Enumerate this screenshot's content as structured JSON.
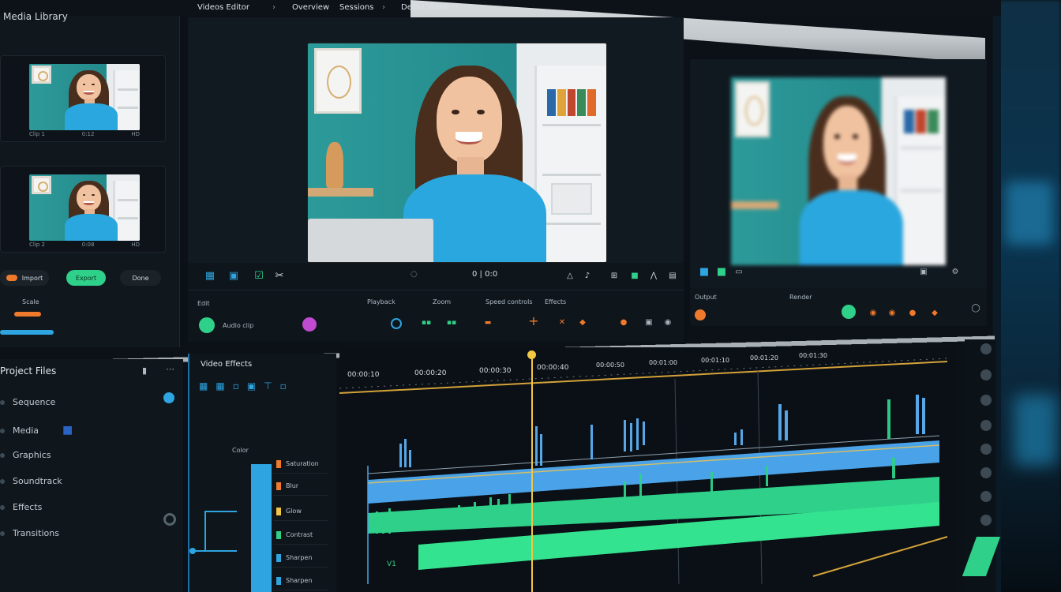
{
  "breadcrumb": {
    "app": "Videos Editor",
    "item1": "Overview",
    "item2": "Sessions",
    "item3": "Demo Video"
  },
  "left_panel": {
    "title": "Media Library",
    "thumb_captions": [
      [
        "Clip 1",
        "0:12",
        "HD"
      ],
      [
        "Clip 2",
        "0:08",
        "HD"
      ]
    ],
    "pills": [
      "Import",
      "Export",
      "Done"
    ],
    "slider_label": "Scale"
  },
  "viewer": {
    "timecode": "0 | 0:0",
    "toolbar_icons": [
      "crop-icon",
      "fit-icon",
      "check-icon",
      "cut-icon"
    ]
  },
  "controls": {
    "label_left": "Edit",
    "label_clip": "Playback",
    "label_zoom": "Zoom",
    "label_speed": "Speed controls",
    "label_effects": "Effects",
    "label_audio": "Audio clip"
  },
  "second_controls": {
    "label": "Output",
    "label2": "Render"
  },
  "project": {
    "title": "Project Files",
    "items": [
      "Sequence",
      "Media",
      "Graphics",
      "Soundtrack",
      "Effects",
      "Transitions"
    ]
  },
  "effects": {
    "title": "Video Effects",
    "group": "Color",
    "rows": [
      "Saturation",
      "Blur",
      "Glow",
      "Contrast",
      "Sharpen"
    ]
  },
  "timeline": {
    "ruler": [
      "00:00:10",
      "00:00:20",
      "00:00:30",
      "00:00:40",
      "00:00:50",
      "00:01:00",
      "00:01:10",
      "00:01:20",
      "00:01:30"
    ],
    "track_label": "V1"
  },
  "colors": {
    "accent_green": "#2fd18a",
    "accent_blue": "#2ea4e0",
    "playhead": "#f2c744",
    "orange": "#f07a2c"
  }
}
